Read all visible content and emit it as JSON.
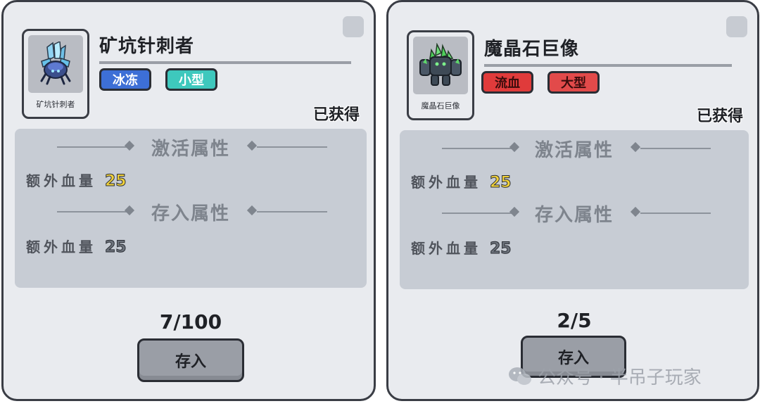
{
  "cards": [
    {
      "name": "矿坑针刺者",
      "portrait_label": "矿坑针刺者",
      "tags": [
        {
          "label": "冰冻",
          "color": "#3d6fd6"
        },
        {
          "label": "小型",
          "color": "#3ec8bd"
        }
      ],
      "status": "已获得",
      "activate_header": "激活属性",
      "activate_attr": {
        "label": "额外血量",
        "value": "25"
      },
      "store_header": "存入属性",
      "store_attr": {
        "label": "额外血量",
        "value": "25"
      },
      "count": "7/100",
      "store_button": "存入"
    },
    {
      "name": "魔晶石巨像",
      "portrait_label": "魔晶石巨像",
      "tags": [
        {
          "label": "流血",
          "color": "#e03b3b"
        },
        {
          "label": "大型",
          "color": "#e24a4a"
        }
      ],
      "status": "已获得",
      "activate_header": "激活属性",
      "activate_attr": {
        "label": "额外血量",
        "value": "25"
      },
      "store_header": "存入属性",
      "store_attr": {
        "label": "额外血量",
        "value": "25"
      },
      "count": "2/5",
      "store_button": "存入"
    }
  ],
  "watermark": "公众号 · 半吊子玩家",
  "colors": {
    "panel": "#c7ccd4",
    "card_bg": "#e9ebef",
    "value_active": "#f2d23a",
    "value_inactive": "#6d737c"
  }
}
